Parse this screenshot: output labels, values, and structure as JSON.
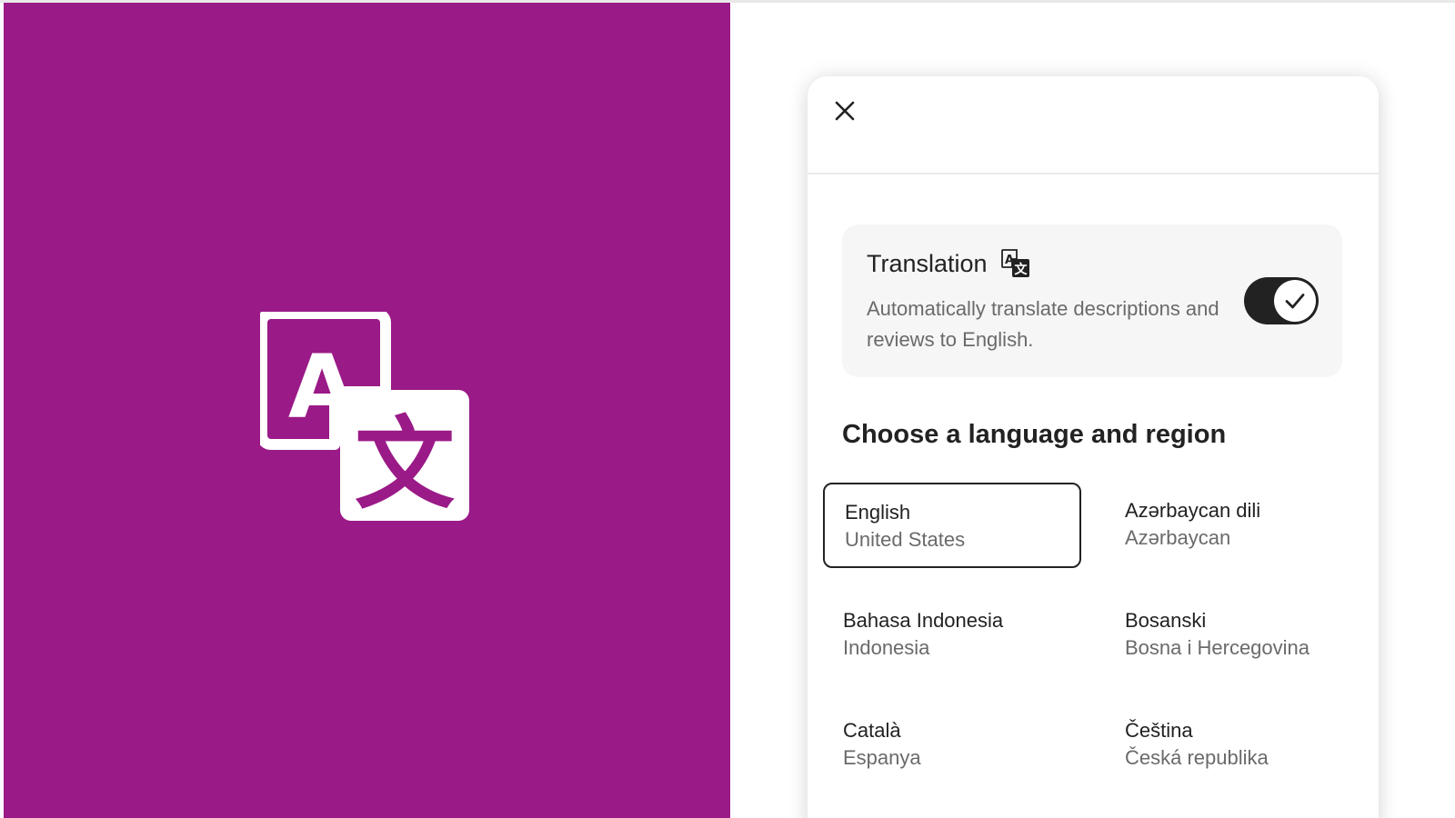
{
  "colors": {
    "brand": "#9a1a87",
    "text_primary": "#222222",
    "text_secondary": "#6a6a6a",
    "card_bg": "#f6f6f6",
    "toggle_on": "#222222"
  },
  "hero": {
    "icon": "translate-icon"
  },
  "modal": {
    "close_icon": "close-icon",
    "translation": {
      "title": "Translation",
      "icon": "translate-icon",
      "description": "Automatically translate descriptions and reviews to English.",
      "enabled": true
    },
    "heading": "Choose a language and region",
    "languages": [
      {
        "name": "English",
        "region": "United States",
        "selected": true
      },
      {
        "name": "Azərbaycan dili",
        "region": "Azərbaycan",
        "selected": false
      },
      {
        "name": "Bahasa Indonesia",
        "region": "Indonesia",
        "selected": false
      },
      {
        "name": "Bosanski",
        "region": "Bosna i Hercegovina",
        "selected": false
      },
      {
        "name": "Català",
        "region": "Espanya",
        "selected": false
      },
      {
        "name": "Čeština",
        "region": "Česká republika",
        "selected": false
      }
    ]
  }
}
